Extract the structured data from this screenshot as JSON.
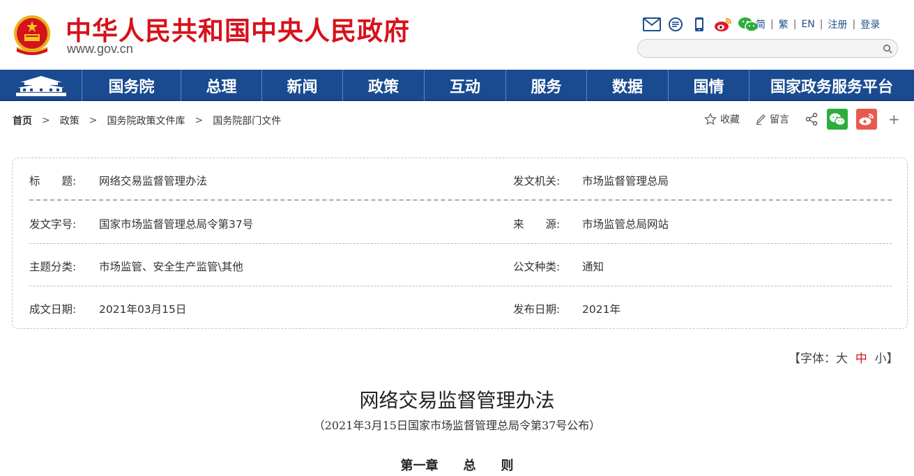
{
  "header": {
    "site_title": "中华人民共和国中央人民政府",
    "site_url": "www.gov.cn",
    "icons": [
      "mail-icon",
      "message-icon",
      "mobile-icon",
      "weibo-icon",
      "wechat-icon"
    ],
    "lang": {
      "simplified": "简",
      "traditional": "繁",
      "english": "EN",
      "register": "注册",
      "login": "登录"
    },
    "search": {
      "placeholder": ""
    }
  },
  "nav": {
    "items": [
      {
        "label": "国务院"
      },
      {
        "label": "总理"
      },
      {
        "label": "新闻"
      },
      {
        "label": "政策"
      },
      {
        "label": "互动"
      },
      {
        "label": "服务"
      },
      {
        "label": "数据"
      },
      {
        "label": "国情"
      },
      {
        "label": "国家政务服务平台"
      }
    ]
  },
  "breadcrumb": {
    "items": [
      "首页",
      "政策",
      "国务院政策文件库",
      "国务院部门文件"
    ],
    "separator": ">"
  },
  "tools": {
    "favorite": "收藏",
    "comment": "留言",
    "more": "+"
  },
  "info": {
    "title_label": "标　　题:",
    "title_value": "网络交易监督管理办法",
    "issuer_label": "发文机关:",
    "issuer_value": "市场监督管理总局",
    "doc_no_label": "发文字号:",
    "doc_no_value": "国家市场监督管理总局令第37号",
    "source_label": "来　　源:",
    "source_value": "市场监管总局网站",
    "topic_label": "主题分类:",
    "topic_value": "市场监管、安全生产监管\\其他",
    "type_label": "公文种类:",
    "type_value": "通知",
    "written_label": "成文日期:",
    "written_value": "2021年03月15日",
    "publish_label": "发布日期:",
    "publish_value": "2021年"
  },
  "fontsize": {
    "prefix": "【字体：",
    "large": "大",
    "medium": "中",
    "small": "小",
    "suffix": "】"
  },
  "document": {
    "title": "网络交易监督管理办法",
    "subtitle": "（2021年3月15日国家市场监督管理总局令第37号公布）",
    "chapter": "第一章　　总　　则"
  },
  "colors": {
    "brand_red": "#d6121b",
    "nav_blue": "#1a4b91",
    "wechat_green": "#2bae3c",
    "weibo_red": "#e8594f"
  }
}
